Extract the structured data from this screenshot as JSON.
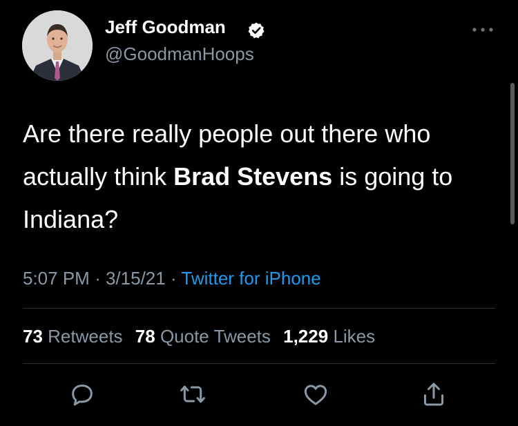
{
  "author": {
    "display_name": "Jeff Goodman",
    "handle": "@GoodmanHoops",
    "verified": true
  },
  "tweet": {
    "text_before": "Are there really people out there who actually think ",
    "text_bold": "Brad Stevens",
    "text_after": " is going to Indiana?",
    "time": "5:07 PM",
    "separator": "·",
    "date": "3/15/21",
    "source": "Twitter for iPhone"
  },
  "stats": {
    "retweets_count": "73",
    "retweets_label": "Retweets",
    "quotes_count": "78",
    "quotes_label": "Quote Tweets",
    "likes_count": "1,229",
    "likes_label": "Likes"
  },
  "actions": [
    "reply-icon",
    "retweet-icon",
    "like-icon",
    "share-icon"
  ],
  "colors": {
    "background": "#000000",
    "text": "#ffffff",
    "secondary": "#8b98a5",
    "link": "#1d9bf0",
    "divider": "#2f3336",
    "icon": "#8b98a5"
  }
}
